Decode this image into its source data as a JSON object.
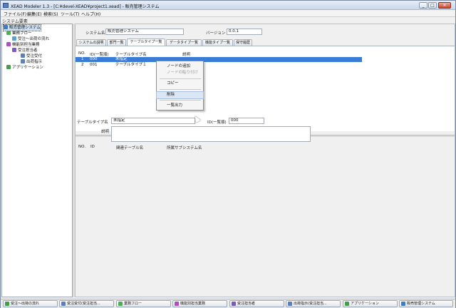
{
  "window": {
    "title": "XEAD Modeler 1.3 - [C:¥devel-XEAD¥project1.xead] - 販売管理システム",
    "minimize": "_",
    "maximize": "□",
    "close": "✕"
  },
  "menu": [
    "ファイル(F)",
    "編集(E)",
    "検索(S)",
    "ツール(T)",
    "ヘルプ(H)"
  ],
  "tree": {
    "header": "システム要素",
    "nodes": [
      {
        "label": "販売管理システム",
        "color": "#3d7cc9"
      },
      {
        "label": "業務フロー",
        "color": "#4caf50"
      },
      {
        "label": "受注～出荷の流れ",
        "color": "#5aa0d8"
      },
      {
        "label": "機能別担当業務",
        "color": "#b04cc4"
      },
      {
        "label": "受注担当者",
        "color": "#7e57c2"
      },
      {
        "label": "受注受付",
        "color": "#5c7fbf"
      },
      {
        "label": "出荷指示",
        "color": "#5c7fbf"
      },
      {
        "label": "アプリケーション",
        "color": "#43a047"
      }
    ]
  },
  "main": {
    "system_name_label": "システム名",
    "system_name_value": "販売管理システム",
    "version_label": "バージョン",
    "version_value": "0.0.1",
    "tabs": [
      "システムの説明",
      "部門一覧",
      "テーブルタイプ一覧",
      "データタイプ一覧",
      "機能タイプ一覧",
      "保守履歴"
    ],
    "active_tab": 2,
    "table_headers": {
      "no": "NO.",
      "id": "ID(一覧順)",
      "name": "テーブルタイプ名",
      "desc": "説明"
    },
    "rows": [
      {
        "no": "1",
        "id": "000",
        "name": "未指定"
      },
      {
        "no": "2",
        "id": "001",
        "name": "テーブルタイプ１"
      }
    ],
    "context_menu": [
      "ノードの追加",
      "ノードの貼り付け",
      "コピー",
      "削除",
      "一覧出力"
    ],
    "detail": {
      "name_label": "テーブルタイプ名",
      "name_value": "未指定",
      "id_label": "ID(一覧順)",
      "id_value": "000",
      "desc_label": "説明"
    },
    "rel_headers": {
      "no": "NO.",
      "id": "ID",
      "table": "関連テーブル名",
      "subsystem": "所属サブシステム名"
    }
  },
  "statusbar": [
    {
      "label": "受注～出荷の流れ",
      "color": "#43a047"
    },
    {
      "label": "受注受付(受注担当...",
      "color": "#5c7fbf"
    },
    {
      "label": "業務フロー",
      "color": "#4caf50"
    },
    {
      "label": "機能別担当業務",
      "color": "#b04cc4"
    },
    {
      "label": "受注担当者",
      "color": "#7e57c2"
    },
    {
      "label": "出荷指示(受注担当...",
      "color": "#5c7fbf"
    },
    {
      "label": "アプリケーション",
      "color": "#43a047"
    },
    {
      "label": "販売管理システム",
      "color": "#3d7cc9"
    }
  ]
}
